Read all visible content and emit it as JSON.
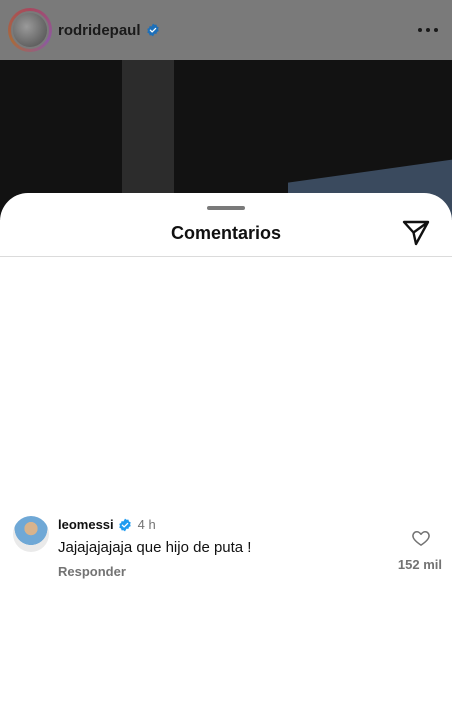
{
  "post": {
    "username": "rodridepaul",
    "verified_icon": "verified-badge-icon",
    "more_icon": "more-horizontal-icon"
  },
  "comments_sheet": {
    "title": "Comentarios",
    "share_icon": "send-icon"
  },
  "comments": [
    {
      "username": "leomessi",
      "time": "4 h",
      "text": "Jajajajajaja que hijo de puta !",
      "reply_label": "Responder",
      "likes": "152 mil"
    }
  ],
  "colors": {
    "verified": "#1d9bf0",
    "muted_text": "#737373"
  }
}
